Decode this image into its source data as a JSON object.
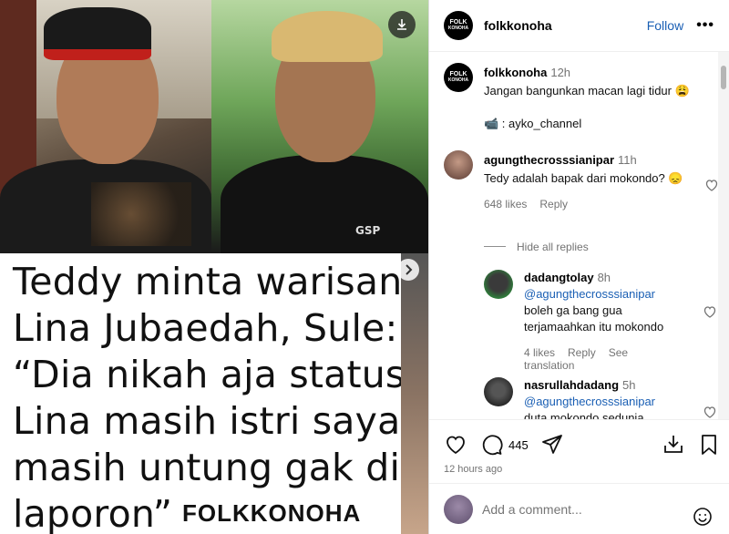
{
  "post": {
    "caption_lines": [
      "Teddy minta warisan",
      "Lina Jubaedah, Sule:",
      "“Dia nikah aja status",
      "Lina masih istri saya,",
      "masih untung gak di",
      "laporon”"
    ],
    "brand": "FOLKKONOHA",
    "shirt_logo": "GSP"
  },
  "header": {
    "avatar_text_top": "FOLK",
    "avatar_text_bottom": "KONOHA",
    "username": "folkkonoha",
    "follow_label": "Follow",
    "more_label": "•••"
  },
  "caption_comment": {
    "username": "folkkonoha",
    "time": "12h",
    "text": "Jangan bangunkan macan lagi tidur 😩",
    "credit": "📹 : ayko_channel"
  },
  "comments": [
    {
      "username": "agungthecrosssianipar",
      "time": "11h",
      "text": "Tedy adalah bapak dari mokondo? 😞",
      "likes": "648 likes",
      "reply": "Reply",
      "hide_replies": "Hide all replies"
    }
  ],
  "replies": [
    {
      "username": "dadangtolay",
      "time": "8h",
      "mention": "@agungthecrosssianipar",
      "text": "boleh ga bang gua terjamaahkan itu mokondo",
      "likes": "4 likes",
      "reply": "Reply",
      "translation": "See translation"
    },
    {
      "username": "nasrullahdadang",
      "time": "5h",
      "mention": "@agungthecrosssianipar",
      "text": "duta mokondo sedunia"
    }
  ],
  "actions": {
    "comment_count": "445",
    "posted_ago": "12 hours ago"
  },
  "add_comment": {
    "placeholder": "Add a comment..."
  },
  "colors": {
    "link_blue": "#1a5fb4",
    "muted_gray": "#737373"
  }
}
